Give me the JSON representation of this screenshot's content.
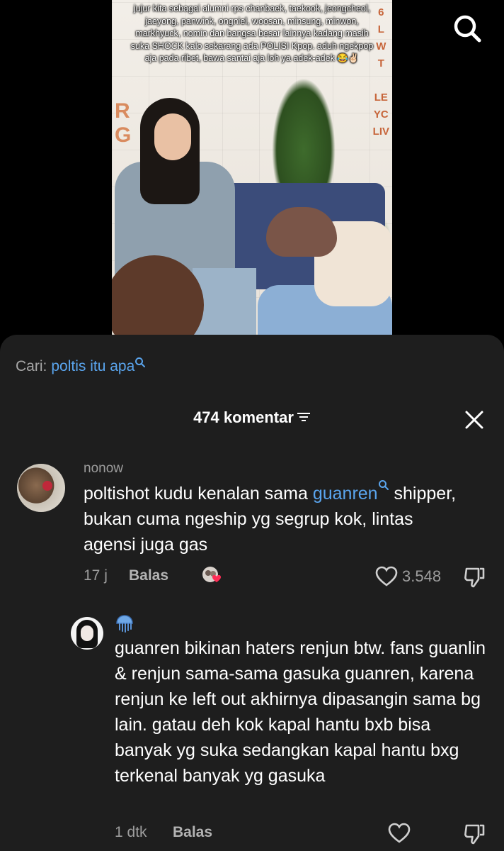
{
  "video": {
    "caption": "jujur kita sebagai alumni rps chanbaek, taekook, jeongcheol, jaeyong, panwink, ongniel, woosan, minsung, minwon, markhyuck, nomin dan bangsa besar lainnya kadang masih suka SHOCK kalo sekarang ada POLISI Kpop. aduh ngekpop aja pada ribet, bawa santai aja loh ya adek-adek 😂✌🏻",
    "search_icon": "search-icon"
  },
  "search": {
    "label": "Cari:",
    "term": "poltis itu apa"
  },
  "comments_header": {
    "count_label": "474 komentar",
    "filter_icon": "filter-icon",
    "close_icon": "close-icon"
  },
  "comments": [
    {
      "username": "nonow",
      "text_before": "poltishot kudu kenalan sama ",
      "highlight": "guanren",
      "text_after": " shipper, bukan cuma ngeship yg segrup kok, lintas agensi juga gas",
      "time": "17 j",
      "reply_label": "Balas",
      "likes": "3.548"
    },
    {
      "username_icon": "jellyfish-emoji-icon",
      "text": "guanren bikinan haters renjun btw. fans guanlin & renjun sama-sama gasuka guanren, karena renjun ke left out akhirnya dipasangin sama bg lain. gatau deh kok kapal hantu bxb bisa banyak yg suka sedangkan kapal hantu bxg terkenal banyak yg gasuka",
      "time": "1 dtk",
      "reply_label": "Balas"
    }
  ],
  "colors": {
    "sheet_bg": "#1e1e1e",
    "link_blue": "#5aa5ee",
    "muted": "#9d9d9d"
  }
}
